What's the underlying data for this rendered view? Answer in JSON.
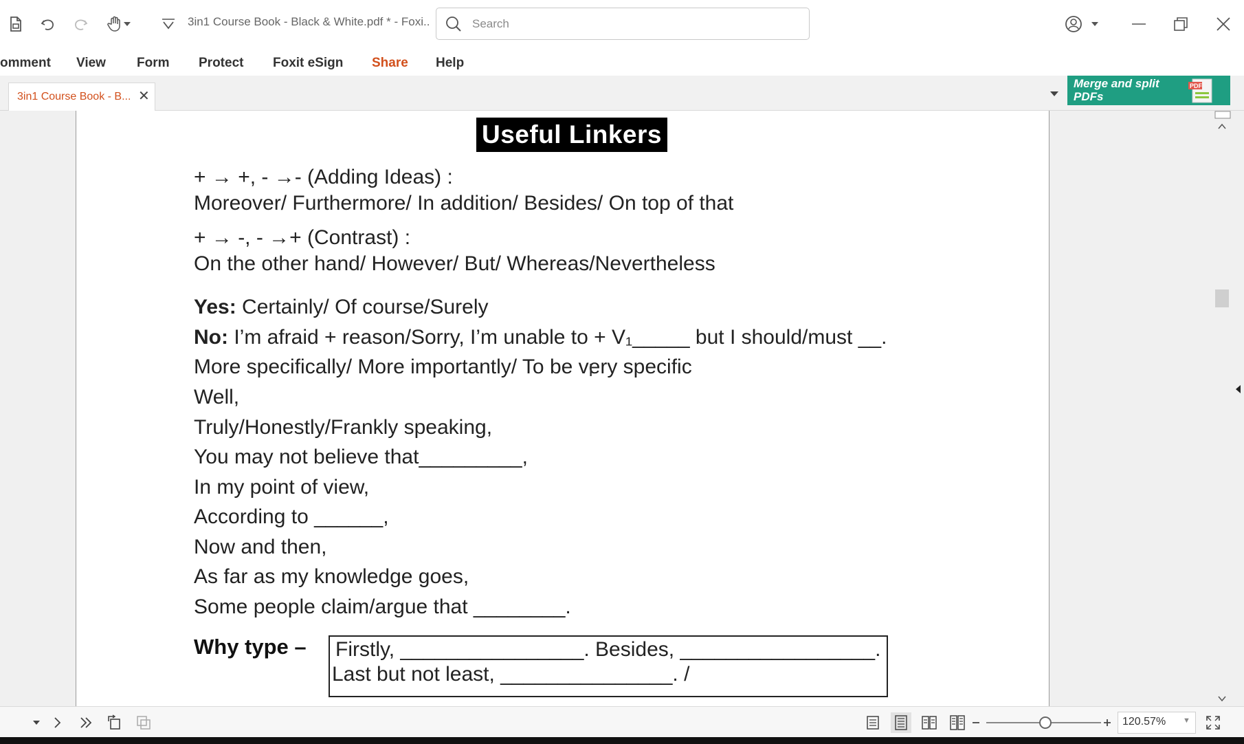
{
  "titlebar": {
    "document_title": "3in1 Course Book - Black & White.pdf * - Foxi...",
    "search_placeholder": "Search"
  },
  "menu": {
    "items": [
      {
        "label": "omment"
      },
      {
        "label": "View"
      },
      {
        "label": "Form"
      },
      {
        "label": "Protect"
      },
      {
        "label": "Foxit eSign"
      },
      {
        "label": "Share",
        "active": true
      },
      {
        "label": "Help"
      }
    ]
  },
  "tabs": {
    "open_tab_label": "3in1 Course Book - B...",
    "close_glyph": "✕",
    "promo_text": "Merge and split PDFs",
    "promo_icon_label": "PDF"
  },
  "document": {
    "heading": "Useful Linkers",
    "adding_title": "+ → +, - →- (Adding Ideas) :",
    "adding_line": "Moreover/ Furthermore/ In addition/ Besides/ On top of that",
    "contrast_title": "+ → -, - →+ (Contrast) :",
    "contrast_line": "On the other hand/ However/ But/ Whereas/Nevertheless",
    "yes_label": "Yes:",
    "yes_text": " Certainly/ Of course/Surely",
    "no_label": "No:",
    "no_text": " I’m afraid + reason/Sorry, I’m unable to + V₁_____ but I should/must __.",
    "lines": [
      "More specifically/ More importantly/ To be very specific",
      "Well,",
      "Truly/Honestly/Frankly speaking,",
      "You may not believe that_________,",
      "In my point of view,",
      "According to ______,",
      "Now and then,",
      "As far as my knowledge goes,",
      "Some people claim/argue that ________."
    ],
    "why_label": "Why type –",
    "why_line1": "Firstly, ________________. Besides, _________________.",
    "why_line2": "Last but not least, _______________. /"
  },
  "statusbar": {
    "zoom": "120.57%"
  },
  "colors": {
    "accent": "#d2501c",
    "promo_bg": "#1f9e82"
  }
}
